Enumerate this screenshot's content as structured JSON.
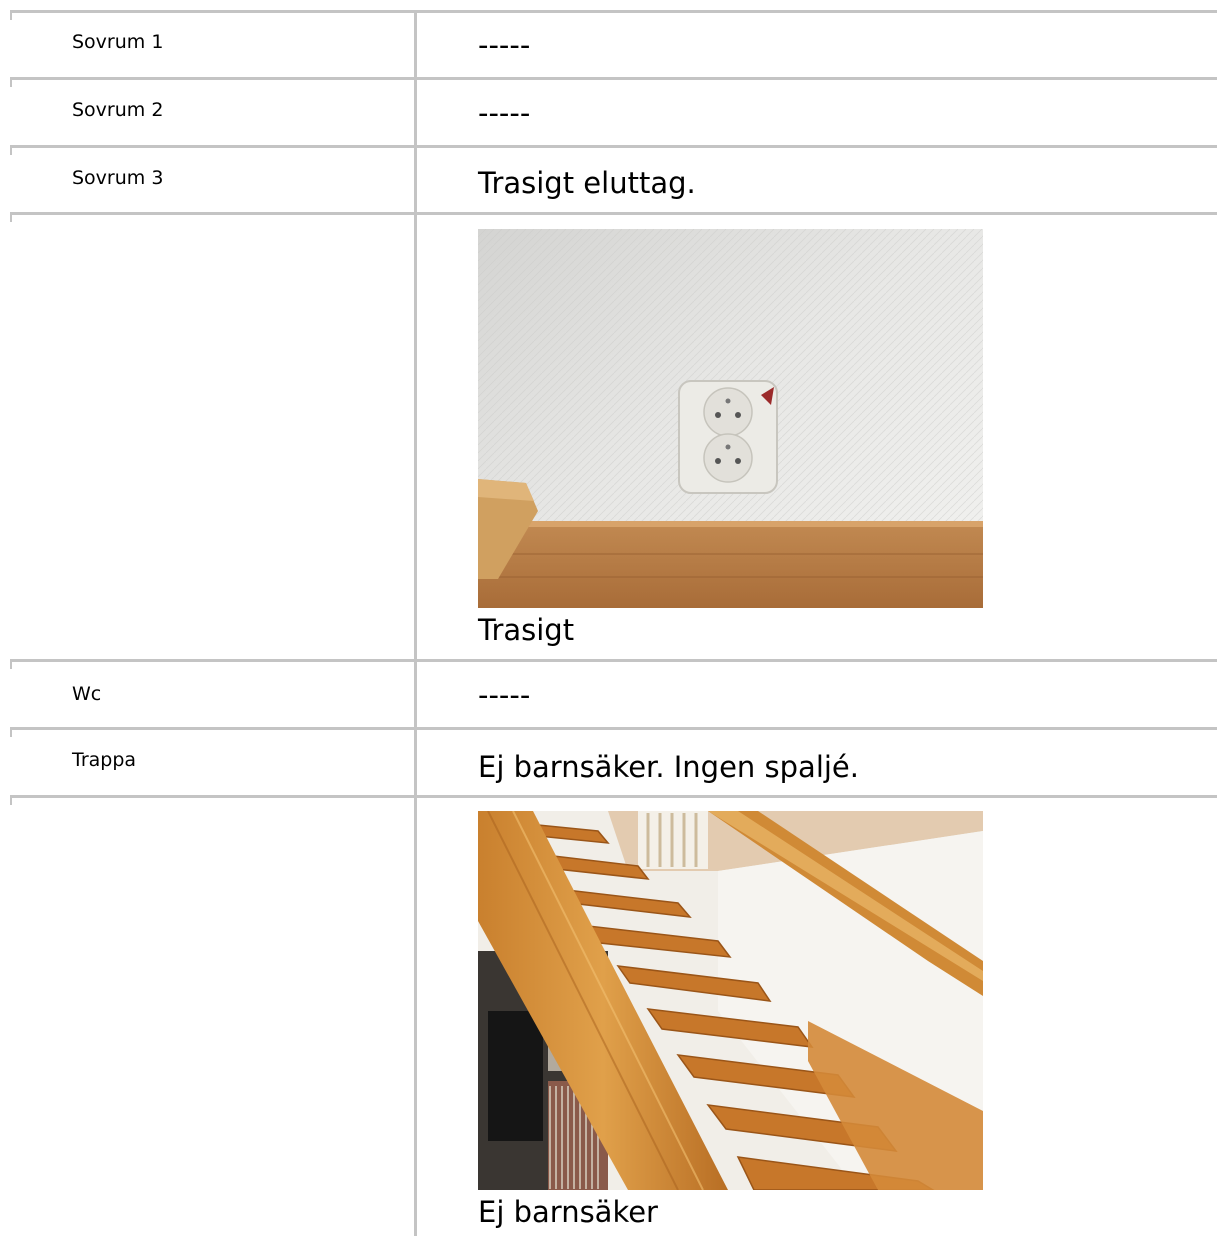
{
  "rows": [
    {
      "label": "Sovrum 1",
      "value": "-----"
    },
    {
      "label": "Sovrum 2",
      "value": "-----"
    },
    {
      "label": "Sovrum 3",
      "value": "Trasigt eluttag."
    },
    {
      "caption": "Trasigt"
    },
    {
      "label": "Wc",
      "value": "-----"
    },
    {
      "label": "Trappa",
      "value": "Ej barnsäker. Ingen spaljé."
    },
    {
      "caption": "Ej barnsäker"
    }
  ]
}
